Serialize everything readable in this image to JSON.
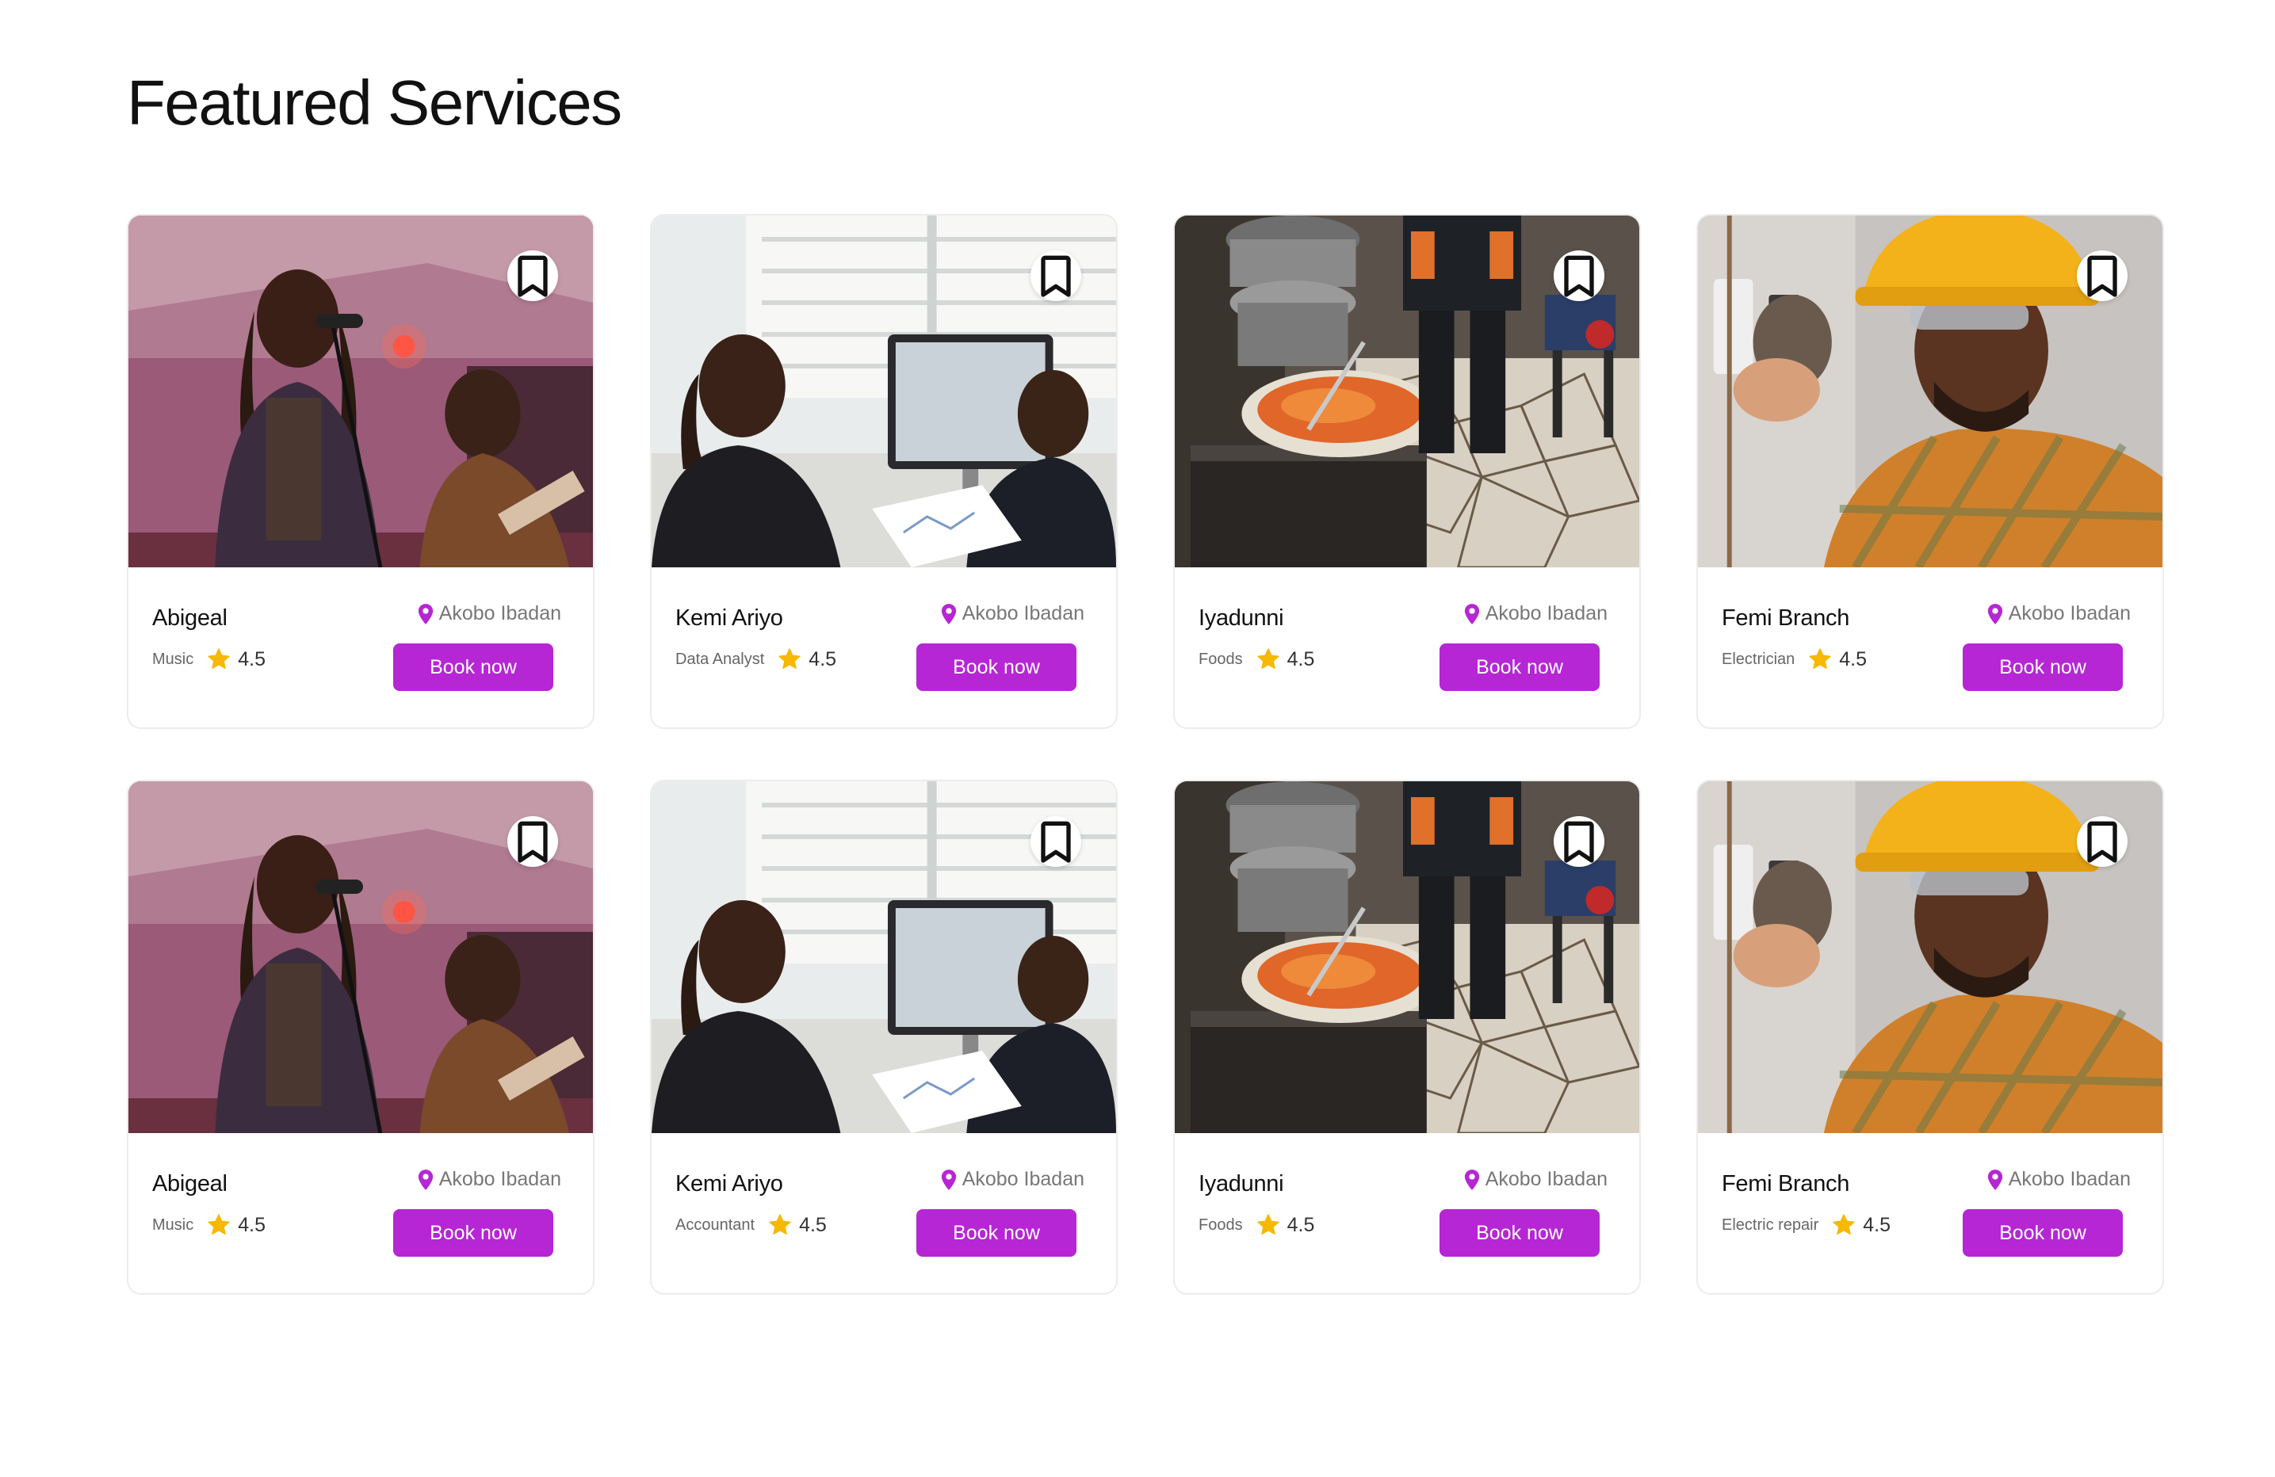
{
  "page": {
    "title": "Featured Services"
  },
  "colors": {
    "accent": "#b626d4",
    "star": "#f7b800",
    "pin": "#b626d4"
  },
  "cards": [
    {
      "name": "Abigeal",
      "category": "Music",
      "rating": "4.5",
      "location": "Akobo Ibadan",
      "cta": "Book now",
      "image": "singer-photo"
    },
    {
      "name": "Kemi Ariyo",
      "category": "Data Analyst",
      "rating": "4.5",
      "location": "Akobo Ibadan",
      "cta": "Book now",
      "image": "office-meeting-photo"
    },
    {
      "name": "Iyadunni",
      "category": "Foods",
      "rating": "4.5",
      "location": "Akobo Ibadan",
      "cta": "Book now",
      "image": "cooking-photo"
    },
    {
      "name": "Femi Branch",
      "category": "Electrician",
      "rating": "4.5",
      "location": "Akobo Ibadan",
      "cta": "Book now",
      "image": "electrician-photo"
    },
    {
      "name": "Abigeal",
      "category": "Music",
      "rating": "4.5",
      "location": "Akobo Ibadan",
      "cta": "Book now",
      "image": "singer-photo"
    },
    {
      "name": "Kemi Ariyo",
      "category": "Accountant",
      "rating": "4.5",
      "location": "Akobo Ibadan",
      "cta": "Book now",
      "image": "office-meeting-photo"
    },
    {
      "name": "Iyadunni",
      "category": "Foods",
      "rating": "4.5",
      "location": "Akobo Ibadan",
      "cta": "Book now",
      "image": "cooking-photo"
    },
    {
      "name": "Femi Branch",
      "category": "Electric repair",
      "rating": "4.5",
      "location": "Akobo Ibadan",
      "cta": "Book now",
      "image": "electrician-photo"
    }
  ]
}
